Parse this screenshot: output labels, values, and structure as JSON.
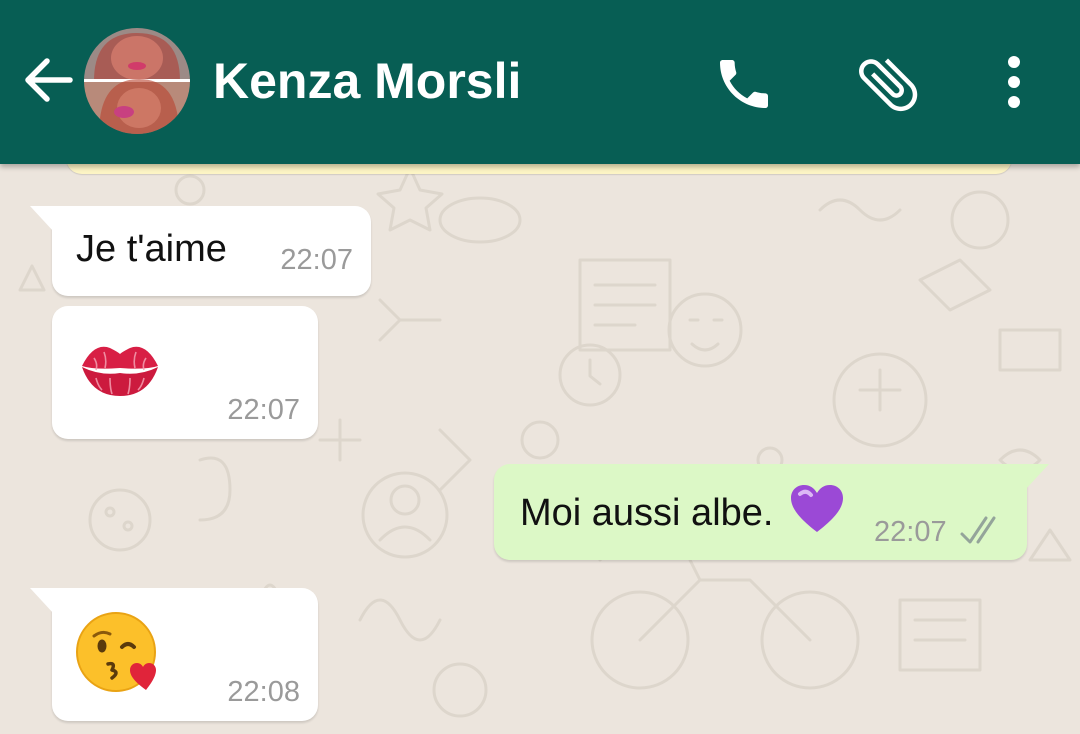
{
  "header": {
    "contact_name": "Kenza Morsli",
    "background_color": "#075e54",
    "icons": [
      "back-arrow-icon",
      "phone-icon",
      "paperclip-icon",
      "more-vertical-icon"
    ]
  },
  "messages": [
    {
      "direction": "incoming",
      "text": "Je t'aime",
      "time": "22:07"
    },
    {
      "direction": "incoming",
      "emoji": "kiss-mark-icon",
      "time": "22:07"
    },
    {
      "direction": "outgoing",
      "text": "Moi aussi albe.",
      "emoji": "purple-heart-icon",
      "time": "22:07",
      "status": "read-double-check"
    },
    {
      "direction": "incoming",
      "emoji": "face-blowing-kiss-icon",
      "time": "22:08"
    }
  ],
  "colors": {
    "incoming_bubble": "#ffffff",
    "outgoing_bubble": "#dcf8c6",
    "chat_background": "#ece5dd",
    "timestamp": "#9a9a9a"
  }
}
